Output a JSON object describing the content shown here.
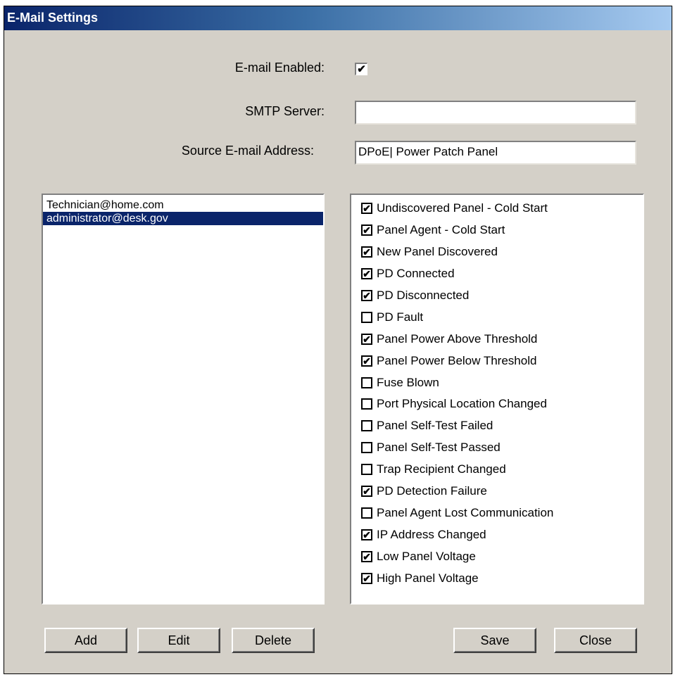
{
  "window": {
    "title": "E-Mail Settings"
  },
  "form": {
    "email_enabled_label": "E-mail Enabled:",
    "email_enabled_checked": true,
    "smtp_label": "SMTP Server:",
    "smtp_value": "",
    "source_label": "Source E-mail Address:",
    "source_value": "DPoE| Power Patch Panel"
  },
  "recipients": [
    {
      "address": "Technician@home.com",
      "selected": false
    },
    {
      "address": "administrator@desk.gov",
      "selected": true
    }
  ],
  "events": [
    {
      "label": "Undiscovered Panel - Cold Start",
      "checked": true
    },
    {
      "label": "Panel Agent - Cold Start",
      "checked": true
    },
    {
      "label": "New Panel Discovered",
      "checked": true
    },
    {
      "label": "PD Connected",
      "checked": true
    },
    {
      "label": "PD Disconnected",
      "checked": true
    },
    {
      "label": "PD Fault",
      "checked": false
    },
    {
      "label": "Panel Power Above Threshold",
      "checked": true
    },
    {
      "label": "Panel Power Below Threshold",
      "checked": true
    },
    {
      "label": "Fuse Blown",
      "checked": false
    },
    {
      "label": "Port Physical Location Changed",
      "checked": false
    },
    {
      "label": "Panel Self-Test Failed",
      "checked": false
    },
    {
      "label": "Panel Self-Test Passed",
      "checked": false
    },
    {
      "label": "Trap Recipient Changed",
      "checked": false
    },
    {
      "label": "PD Detection Failure",
      "checked": true
    },
    {
      "label": "Panel Agent Lost Communication",
      "checked": false
    },
    {
      "label": "IP Address Changed",
      "checked": true
    },
    {
      "label": "Low Panel Voltage",
      "checked": true
    },
    {
      "label": "High Panel Voltage",
      "checked": true
    }
  ],
  "buttons": {
    "add": "Add",
    "edit": "Edit",
    "delete": "Delete",
    "save": "Save",
    "close": "Close"
  },
  "colors": {
    "selection": "#0a246a",
    "dialog_face": "#d4d0c8"
  }
}
